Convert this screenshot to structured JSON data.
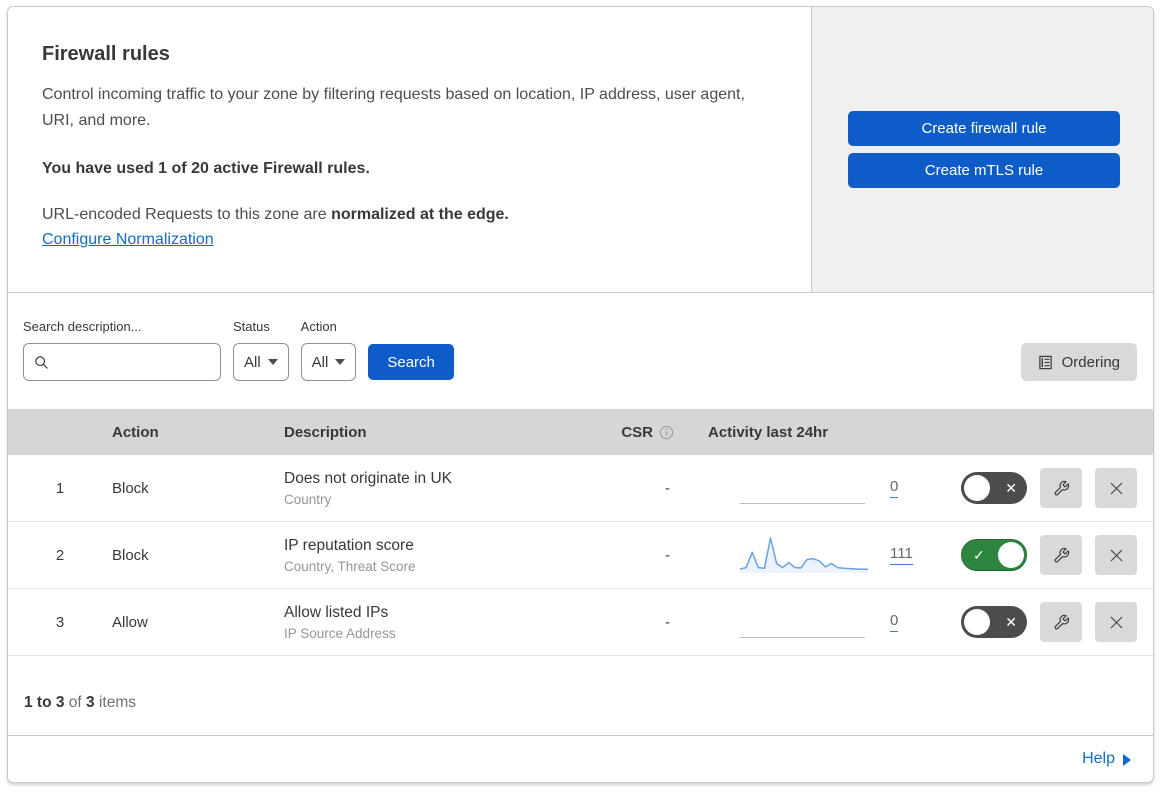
{
  "header": {
    "title": "Firewall rules",
    "description": "Control incoming traffic to your zone by filtering requests based on location, IP address, user agent, URI, and more.",
    "usage": "You have used 1 of 20 active Firewall rules.",
    "normalization_prefix": "URL-encoded Requests to this zone are ",
    "normalization_bold": "normalized at the edge.",
    "normalization_link": "Configure Normalization",
    "create_firewall_label": "Create firewall rule",
    "create_mtls_label": "Create mTLS rule"
  },
  "filters": {
    "search_label": "Search description...",
    "status_label": "Status",
    "status_value": "All",
    "action_label": "Action",
    "action_value": "All",
    "search_button": "Search",
    "ordering_button": "Ordering"
  },
  "table": {
    "columns": {
      "action": "Action",
      "description": "Description",
      "csr": "CSR",
      "activity": "Activity last 24hr"
    },
    "rows": [
      {
        "index": "1",
        "action": "Block",
        "description": "Does not originate in UK",
        "criteria": "Country",
        "csr": "-",
        "activity_count": "0",
        "enabled": false,
        "sparkline": null
      },
      {
        "index": "2",
        "action": "Block",
        "description": "IP reputation score",
        "criteria": "Country, Threat Score",
        "csr": "-",
        "activity_count": "111",
        "enabled": true,
        "sparkline": [
          6,
          10,
          55,
          10,
          8,
          97,
          22,
          10,
          25,
          10,
          9,
          34,
          36,
          30,
          12,
          22,
          10,
          8,
          7,
          6,
          5,
          5
        ]
      },
      {
        "index": "3",
        "action": "Allow",
        "description": "Allow listed IPs",
        "criteria": "IP Source Address",
        "csr": "-",
        "activity_count": "0",
        "enabled": false,
        "sparkline": null
      }
    ]
  },
  "footer": {
    "range": "1 to 3",
    "of_text": " of ",
    "total": "3",
    "items_text": " items",
    "help_label": "Help"
  },
  "icons": {
    "toggle_on_glyph": "✓",
    "toggle_off_glyph": "✕"
  },
  "colors": {
    "accent_blue": "#0d5cc7",
    "link_blue": "#0f6dc9",
    "toggle_on_green": "#2e8540",
    "toggle_off_gray": "#4c4c4c",
    "sparkline_blue": "#6d9fe8",
    "table_header_gray": "#d6d6d6"
  }
}
